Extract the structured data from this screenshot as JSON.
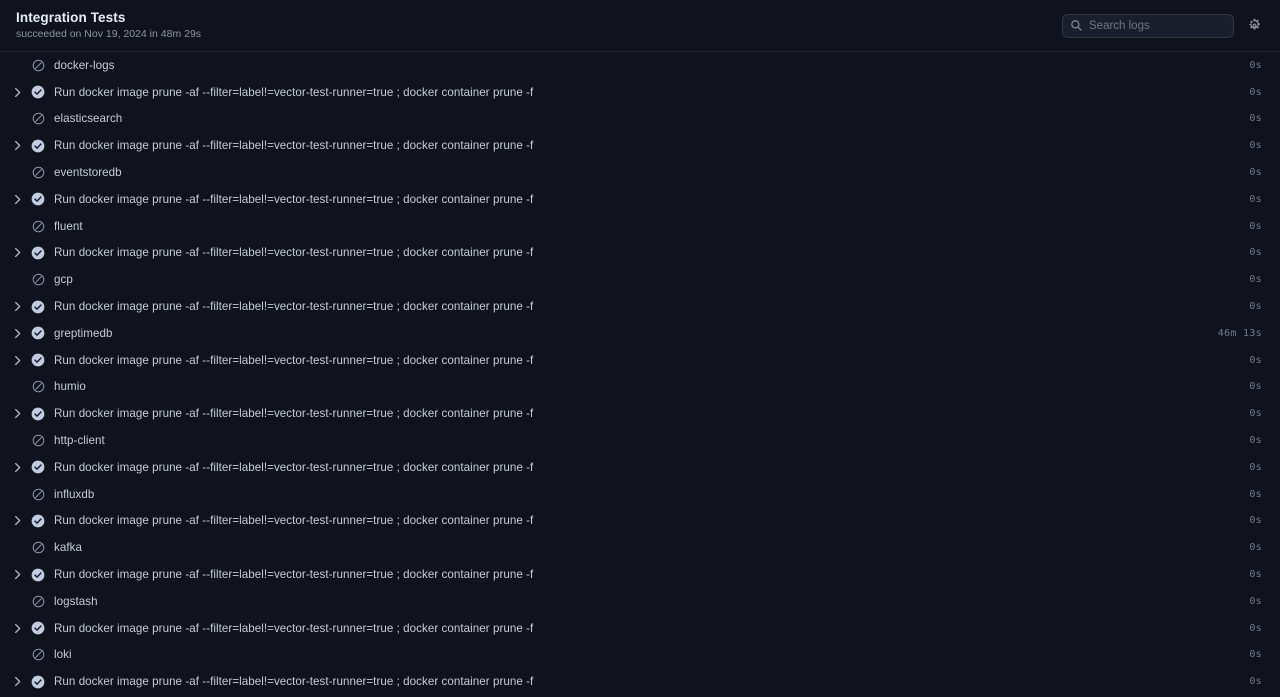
{
  "header": {
    "title": "Integration Tests",
    "subtitle": "succeeded on Nov 19, 2024 in 48m 29s",
    "search": {
      "placeholder": "Search logs",
      "value": "",
      "icon": "search-icon"
    },
    "settings_icon": "gear-icon"
  },
  "icons": {
    "skipped": "skipped-circle-slash-icon",
    "success": "success-check-circle-icon",
    "expand": "chevron-right-icon"
  },
  "colors": {
    "background": "#10131c",
    "header_border": "#21262d",
    "text_primary": "#c5ccd6",
    "text_secondary": "#8b949e",
    "success_icon": "#c3cbe0",
    "skipped_icon": "#8b93a7",
    "duration_text": "#6f7b8c"
  },
  "commands": {
    "docker_prune": "Run docker image prune -af --filter=label!=vector-test-runner=true ; docker container prune -f"
  },
  "log_rows": [
    {
      "label": "docker-logs",
      "status": "skipped",
      "expandable": false,
      "duration": "0s"
    },
    {
      "label": "Run docker image prune -af --filter=label!=vector-test-runner=true ; docker container prune -f",
      "status": "success",
      "expandable": true,
      "duration": "0s"
    },
    {
      "label": "elasticsearch",
      "status": "skipped",
      "expandable": false,
      "duration": "0s"
    },
    {
      "label": "Run docker image prune -af --filter=label!=vector-test-runner=true ; docker container prune -f",
      "status": "success",
      "expandable": true,
      "duration": "0s"
    },
    {
      "label": "eventstoredb",
      "status": "skipped",
      "expandable": false,
      "duration": "0s"
    },
    {
      "label": "Run docker image prune -af --filter=label!=vector-test-runner=true ; docker container prune -f",
      "status": "success",
      "expandable": true,
      "duration": "0s"
    },
    {
      "label": "fluent",
      "status": "skipped",
      "expandable": false,
      "duration": "0s"
    },
    {
      "label": "Run docker image prune -af --filter=label!=vector-test-runner=true ; docker container prune -f",
      "status": "success",
      "expandable": true,
      "duration": "0s"
    },
    {
      "label": "gcp",
      "status": "skipped",
      "expandable": false,
      "duration": "0s"
    },
    {
      "label": "Run docker image prune -af --filter=label!=vector-test-runner=true ; docker container prune -f",
      "status": "success",
      "expandable": true,
      "duration": "0s"
    },
    {
      "label": "greptimedb",
      "status": "success",
      "expandable": true,
      "duration": "46m 13s"
    },
    {
      "label": "Run docker image prune -af --filter=label!=vector-test-runner=true ; docker container prune -f",
      "status": "success",
      "expandable": true,
      "duration": "0s"
    },
    {
      "label": "humio",
      "status": "skipped",
      "expandable": false,
      "duration": "0s"
    },
    {
      "label": "Run docker image prune -af --filter=label!=vector-test-runner=true ; docker container prune -f",
      "status": "success",
      "expandable": true,
      "duration": "0s"
    },
    {
      "label": "http-client",
      "status": "skipped",
      "expandable": false,
      "duration": "0s"
    },
    {
      "label": "Run docker image prune -af --filter=label!=vector-test-runner=true ; docker container prune -f",
      "status": "success",
      "expandable": true,
      "duration": "0s"
    },
    {
      "label": "influxdb",
      "status": "skipped",
      "expandable": false,
      "duration": "0s"
    },
    {
      "label": "Run docker image prune -af --filter=label!=vector-test-runner=true ; docker container prune -f",
      "status": "success",
      "expandable": true,
      "duration": "0s"
    },
    {
      "label": "kafka",
      "status": "skipped",
      "expandable": false,
      "duration": "0s"
    },
    {
      "label": "Run docker image prune -af --filter=label!=vector-test-runner=true ; docker container prune -f",
      "status": "success",
      "expandable": true,
      "duration": "0s"
    },
    {
      "label": "logstash",
      "status": "skipped",
      "expandable": false,
      "duration": "0s"
    },
    {
      "label": "Run docker image prune -af --filter=label!=vector-test-runner=true ; docker container prune -f",
      "status": "success",
      "expandable": true,
      "duration": "0s"
    },
    {
      "label": "loki",
      "status": "skipped",
      "expandable": false,
      "duration": "0s"
    },
    {
      "label": "Run docker image prune -af --filter=label!=vector-test-runner=true ; docker container prune -f",
      "status": "success",
      "expandable": true,
      "duration": "0s"
    }
  ]
}
